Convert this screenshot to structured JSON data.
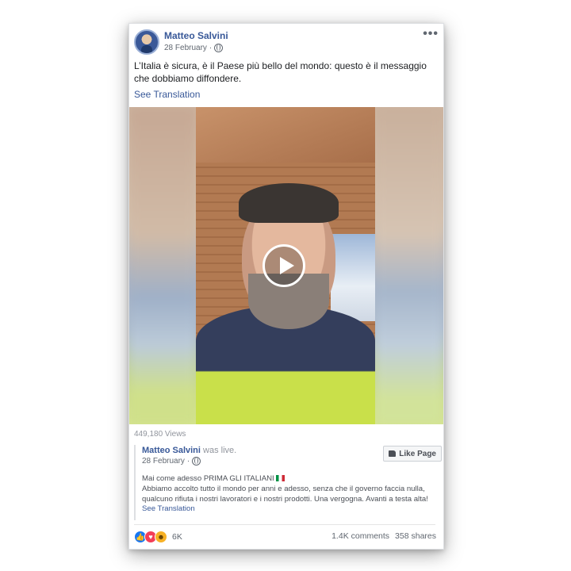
{
  "post": {
    "author": "Matteo Salvini",
    "date": "28 February",
    "text": "L’Italia è sicura, è il Paese più bello del mondo: questo è il messaggio che dobbiamo diffondere.",
    "see_translation": "See Translation",
    "menu_icon": "•••",
    "views": "449,180 Views"
  },
  "shared": {
    "author": "Matteo Salvini",
    "status": "was live.",
    "date": "28 February",
    "like_page": "Like Page",
    "line1": "Mai come adesso PRIMA GLI ITALIANI",
    "line2": "Abbiamo accolto tutto il mondo per anni e adesso, senza che il governo faccia nulla,",
    "line3": "qualcuno rifiuta i nostri lavoratori e i nostri prodotti. Una vergogna. Avanti a testa alta!",
    "see_translation": "See Translation"
  },
  "footer": {
    "reaction_count": "6K",
    "comments": "1.4K comments",
    "shares": "358 shares"
  },
  "colors": {
    "link": "#385898",
    "meta": "#606770",
    "accent": "#1877f2"
  },
  "icons": [
    "globe-icon",
    "play-icon",
    "thumbs-up-icon",
    "like-reaction-icon",
    "love-reaction-icon",
    "haha-reaction-icon",
    "more-icon",
    "flag-italy-icon"
  ]
}
